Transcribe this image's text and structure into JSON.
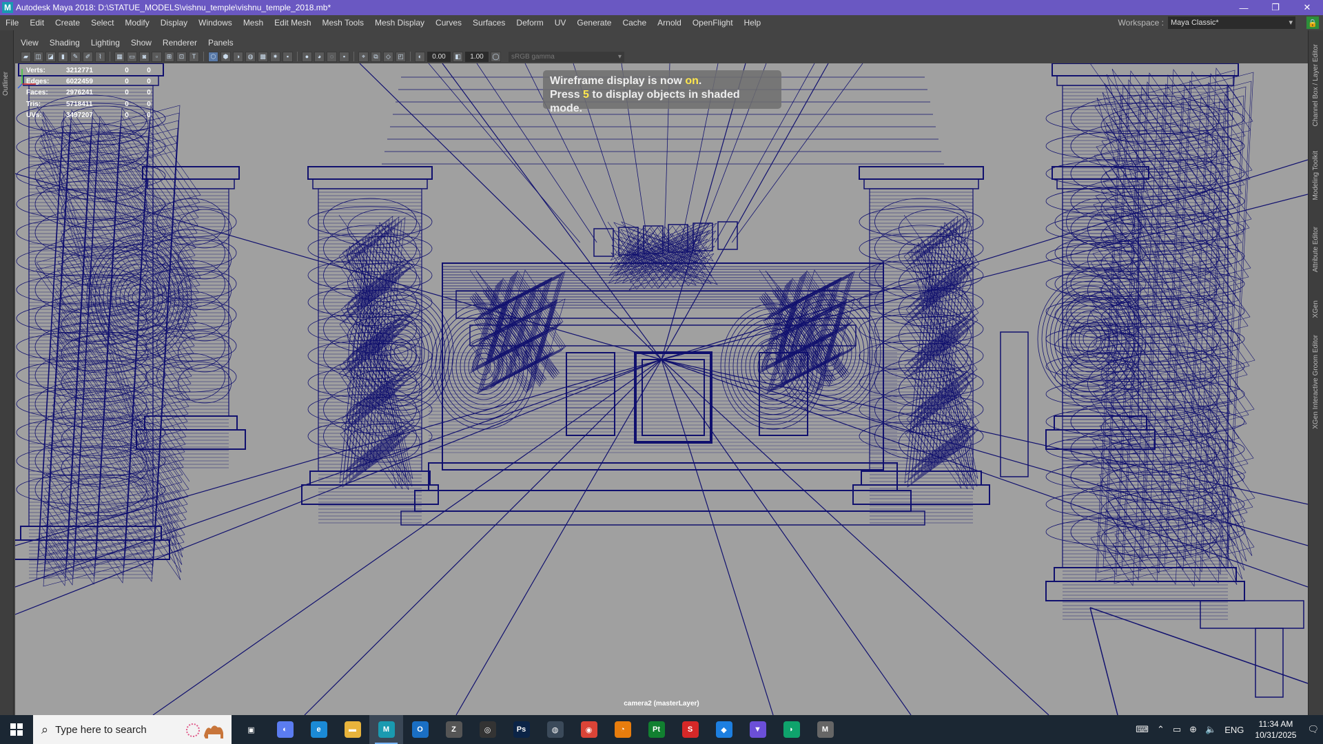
{
  "window": {
    "app_icon": "M",
    "title": "Autodesk Maya 2018: D:\\STATUE_MODELS\\vishnu_temple\\vishnu_temple_2018.mb*",
    "controls": [
      "—",
      "❐",
      "✕"
    ]
  },
  "menubar": {
    "items": [
      "File",
      "Edit",
      "Create",
      "Select",
      "Modify",
      "Display",
      "Windows",
      "Mesh",
      "Edit Mesh",
      "Mesh Tools",
      "Mesh Display",
      "Curves",
      "Surfaces",
      "Deform",
      "UV",
      "Generate",
      "Cache",
      "Arnold",
      "OpenFlight",
      "Help"
    ],
    "workspace_label": "Workspace :",
    "workspace_value": "Maya Classic*"
  },
  "left_strip": {
    "tab": "Outliner"
  },
  "right_strip": {
    "tabs": [
      "Channel Box / Layer Editor",
      "Modeling Toolkit",
      "Attribute Editor",
      "XGen",
      "XGen Interactive Groom Editor"
    ]
  },
  "panel_menu": {
    "items": [
      "View",
      "Shading",
      "Lighting",
      "Show",
      "Renderer",
      "Panels"
    ]
  },
  "toolbar": {
    "gamma_value": "0.00",
    "exposure_value": "1.00",
    "color_space": "sRGB gamma"
  },
  "hud": {
    "rows": [
      {
        "label": "Verts:",
        "value": "3212771",
        "sel": "0",
        "comp": "0"
      },
      {
        "label": "Edges:",
        "value": "6022459",
        "sel": "0",
        "comp": "0"
      },
      {
        "label": "Faces:",
        "value": "2976241",
        "sel": "0",
        "comp": "0"
      },
      {
        "label": "Tris:",
        "value": "5718411",
        "sel": "0",
        "comp": "0"
      },
      {
        "label": "UVs:",
        "value": "3497207",
        "sel": "0",
        "comp": "0"
      }
    ]
  },
  "message": {
    "line1_pre": "Wireframe display is now ",
    "line1_hl": "on",
    "line1_post": ".",
    "line2_pre": "Press ",
    "line2_hl": "5",
    "line2_post": " to display objects in shaded mode."
  },
  "camera_label": "camera2 (masterLayer)",
  "colors": {
    "viewport_bg": "#a0a0a0",
    "wireframe": "#10106e",
    "titlebar": "#6a58c2",
    "highlight": "#ffe74c"
  },
  "taskbar": {
    "search_placeholder": "Type here to search",
    "apps": [
      {
        "name": "task-view",
        "glyph": "▣",
        "color": "transparent"
      },
      {
        "name": "copilot",
        "glyph": "◐",
        "color": "#5b7cf0"
      },
      {
        "name": "edge",
        "glyph": "e",
        "color": "#1b8ad6"
      },
      {
        "name": "file-explorer",
        "glyph": "▬",
        "color": "#e8b43c"
      },
      {
        "name": "maya",
        "glyph": "M",
        "color": "#1a9ab0"
      },
      {
        "name": "outlook",
        "glyph": "O",
        "color": "#1a6fc4"
      },
      {
        "name": "zbrush",
        "glyph": "Z",
        "color": "#555"
      },
      {
        "name": "capture",
        "glyph": "◎",
        "color": "#333"
      },
      {
        "name": "photoshop",
        "glyph": "Ps",
        "color": "#0b2447"
      },
      {
        "name": "unreal",
        "glyph": "◍",
        "color": "#3b4a5a"
      },
      {
        "name": "chrome",
        "glyph": "◉",
        "color": "#db4437"
      },
      {
        "name": "blender",
        "glyph": "◔",
        "color": "#e87d0d"
      },
      {
        "name": "pycharm",
        "glyph": "Pt",
        "color": "#118030"
      },
      {
        "name": "substance",
        "glyph": "S",
        "color": "#d62828"
      },
      {
        "name": "app-blue",
        "glyph": "◆",
        "color": "#1d7fe0"
      },
      {
        "name": "app-purple",
        "glyph": "▼",
        "color": "#6b4fd8"
      },
      {
        "name": "app-green",
        "glyph": "◗",
        "color": "#0fa36c"
      },
      {
        "name": "app-gray",
        "glyph": "M",
        "color": "#666"
      }
    ],
    "language": "ENG",
    "time": "11:34 AM",
    "date": "10/31/2025"
  }
}
